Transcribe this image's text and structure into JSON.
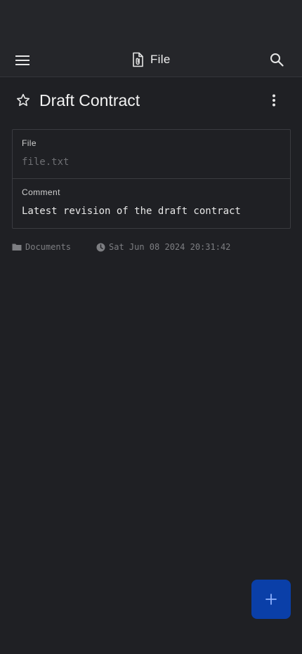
{
  "app_bar": {
    "title": "File",
    "menu_icon": "hamburger-menu-icon",
    "title_icon": "file-attachment-icon",
    "search_icon": "search-icon"
  },
  "item": {
    "title": "Draft Contract",
    "favorite_icon": "star-outline-icon",
    "more_icon": "more-vert-icon"
  },
  "fields": {
    "file_label": "File",
    "file_value": "file.txt",
    "comment_label": "Comment",
    "comment_value": "Latest revision of the draft contract"
  },
  "meta": {
    "folder": "Documents",
    "folder_icon": "folder-icon",
    "date": "Sat Jun 08 2024 20:31:42",
    "date_icon": "clock-icon"
  },
  "fab": {
    "icon": "plus-icon"
  },
  "colors": {
    "background": "#1f2024",
    "appbar": "#25262a",
    "fab": "#0a3fa8",
    "fab_icon": "#8fb2ff"
  }
}
